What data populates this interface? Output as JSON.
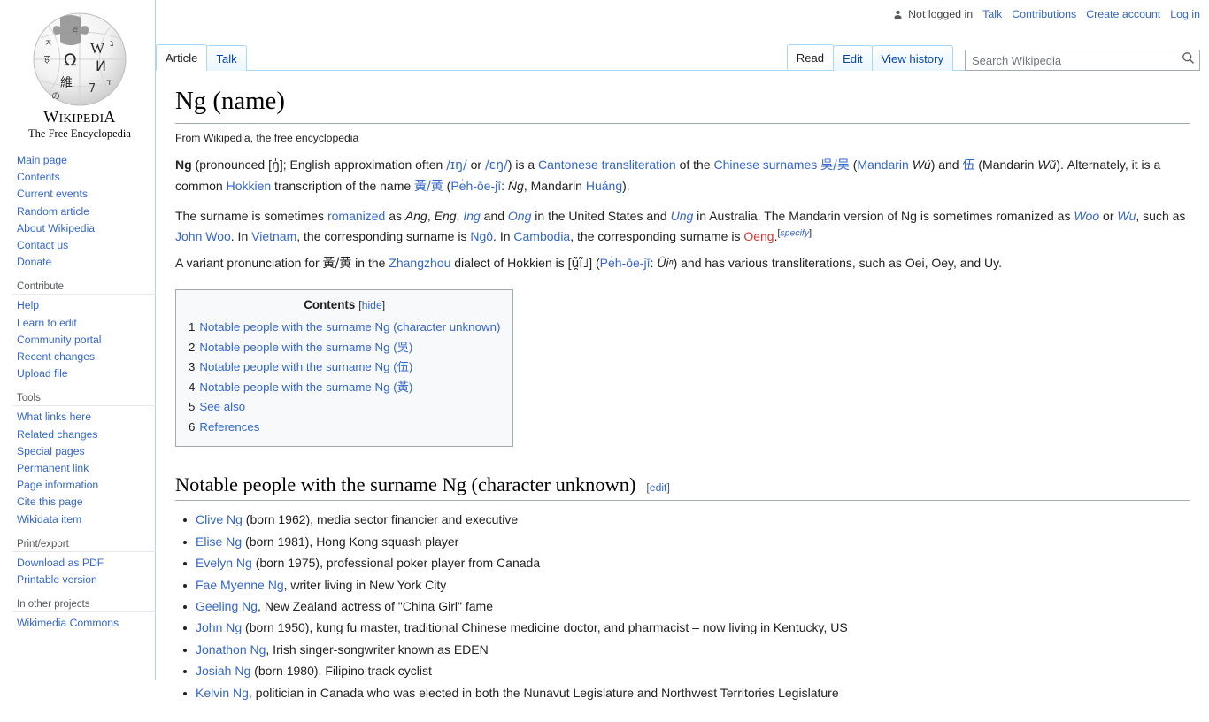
{
  "personal": {
    "not_logged_in": "Not logged in",
    "links": [
      "Talk",
      "Contributions",
      "Create account",
      "Log in"
    ]
  },
  "logo": {
    "wordmark": "WIKIPEDIA",
    "tagline": "The Free Encyclopedia"
  },
  "tabs": {
    "left": [
      {
        "label": "Article",
        "selected": true
      },
      {
        "label": "Talk",
        "selected": false
      }
    ],
    "right": [
      {
        "label": "Read",
        "selected": true
      },
      {
        "label": "Edit",
        "selected": false
      },
      {
        "label": "View history",
        "selected": false
      }
    ]
  },
  "search": {
    "placeholder": "Search Wikipedia",
    "value": ""
  },
  "sidebar": {
    "sections": [
      {
        "heading": "",
        "items": [
          "Main page",
          "Contents",
          "Current events",
          "Random article",
          "About Wikipedia",
          "Contact us",
          "Donate"
        ]
      },
      {
        "heading": "Contribute",
        "items": [
          "Help",
          "Learn to edit",
          "Community portal",
          "Recent changes",
          "Upload file"
        ]
      },
      {
        "heading": "Tools",
        "items": [
          "What links here",
          "Related changes",
          "Special pages",
          "Permanent link",
          "Page information",
          "Cite this page",
          "Wikidata item"
        ]
      },
      {
        "heading": "Print/export",
        "items": [
          "Download as PDF",
          "Printable version"
        ]
      },
      {
        "heading": "In other projects",
        "items": [
          "Wikimedia Commons"
        ]
      }
    ]
  },
  "article": {
    "title": "Ng (name)",
    "subtitle": "From Wikipedia, the free encyclopedia",
    "paragraph1": {
      "lead_bold": "Ng",
      "t1": " (pronounced [",
      "ipa1": "ŋ̍",
      "t2": "]; English approximation often ",
      "link_ipa_a": "/ɪŋ/",
      "t3": " or ",
      "link_ipa_b": "/ɛŋ/",
      "t4": ") is a ",
      "link_cantonese": "Cantonese transliteration",
      "t5": " of the ",
      "link_chinese_surnames": "Chinese surnames",
      "t6": " ",
      "cjk1": "吳/吴",
      "t7": " (",
      "link_mandarin1": "Mandarin",
      "t8": " ",
      "it1": "Wú",
      "t9": ") and ",
      "cjk2": "伍",
      "t10": " (Mandarin ",
      "it2": "Wǔ",
      "t11": "). Alternately, it is a common ",
      "link_hokkien": "Hokkien",
      "t12": " transcription of the name ",
      "cjk3": "黃/黄",
      "t13": " (",
      "link_poj": "Pe̍h-ōe-jī",
      "t14": ": ",
      "it3": "Ńg",
      "t15": ", Mandarin ",
      "link_huang": "Huáng",
      "t16": ")."
    },
    "paragraph2": {
      "t1": "The surname is sometimes ",
      "link_romanized": "romanized",
      "t2": " as ",
      "it_ang": "Ang",
      "t3": ", ",
      "it_eng": "Eng",
      "t4": ", ",
      "link_ing": "Ing",
      "t5": " and ",
      "link_ong": "Ong",
      "t6": " in the United States and ",
      "link_ung": "Ung",
      "t7": " in Australia. The Mandarin version of Ng is sometimes romanized as ",
      "link_woo": "Woo",
      "t8": " or ",
      "link_wu": "Wu",
      "t9": ", such as ",
      "link_johnwoo": "John Woo",
      "t10": ". In ",
      "link_vietnam": "Vietnam",
      "t11": ", the corresponding surname is ",
      "link_ngo": "Ngô",
      "t12": ". In ",
      "link_cambodia": "Cambodia",
      "t13": ", the corresponding surname is ",
      "redlink_oeng": "Oeng",
      "t14": ".",
      "sup_specify": "specify"
    },
    "paragraph3": {
      "t1": "A variant pronunciation for ",
      "cjk1": "黃/黄",
      "t2": " in the ",
      "link_zhangzhou": "Zhangzhou",
      "t3": " dialect of Hokkien is [",
      "ipa1": "ũ̯ĩ˩",
      "t4": "] (",
      "link_poj": "Pe̍h-ōe-jī",
      "t5": ": ",
      "it1": "Ûiⁿ",
      "t6": ") and has various transliterations, such as Oei, Oey, and Uy."
    },
    "toc": {
      "title": "Contents",
      "toggle_open": "[",
      "toggle_label": "hide",
      "toggle_close": "]",
      "entries": [
        {
          "number": "1",
          "text": "Notable people with the surname Ng (character unknown)"
        },
        {
          "number": "2",
          "text": "Notable people with the surname Ng (吳)"
        },
        {
          "number": "3",
          "text": "Notable people with the surname Ng (伍)"
        },
        {
          "number": "4",
          "text": "Notable people with the surname Ng (黃)"
        },
        {
          "number": "5",
          "text": "See also"
        },
        {
          "number": "6",
          "text": "References"
        }
      ]
    },
    "section1": {
      "heading": "Notable people with the surname Ng (character unknown)",
      "edit_open": "[",
      "edit_label": "edit",
      "edit_close": "]",
      "people": [
        {
          "name": "Clive Ng",
          "desc": " (born 1962), media sector financier and executive"
        },
        {
          "name": "Elise Ng",
          "desc": " (born 1981), Hong Kong squash player"
        },
        {
          "name": "Evelyn Ng",
          "desc": " (born 1975), professional poker player from Canada"
        },
        {
          "name": "Fae Myenne Ng",
          "desc": ", writer living in New York City"
        },
        {
          "name": "Geeling Ng",
          "desc": ", New Zealand actress of \"China Girl\" fame"
        },
        {
          "name": "John Ng",
          "desc": " (born 1950), kung fu master, traditional Chinese medicine doctor, and pharmacist – now living in Kentucky, US"
        },
        {
          "name": "Jonathon Ng",
          "desc": ", Irish singer-songwriter known as EDEN"
        },
        {
          "name": "Josiah Ng",
          "desc": " (born 1980), Filipino track cyclist"
        },
        {
          "name": "Kelvin Ng",
          "desc": ", politician in Canada who was elected in both the Nunavut Legislature and Northwest Territories Legislature"
        }
      ]
    }
  },
  "colors": {
    "link": "#3366cc",
    "redlink": "#d73333",
    "tab_border": "#a7d7f9",
    "rule": "#a2a9b1",
    "toc_bg": "#f8f9fa"
  }
}
